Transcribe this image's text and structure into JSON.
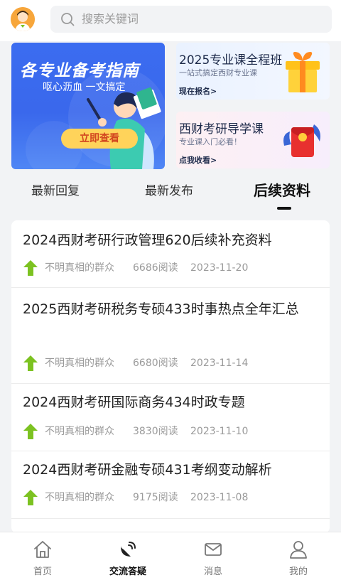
{
  "search": {
    "placeholder": "搜索关键词"
  },
  "banners": {
    "main": {
      "title": "各专业备考指南",
      "subtitle": "呕心沥血 一文搞定",
      "cta": "立即查看"
    },
    "side": [
      {
        "title": "2025专业课全程班",
        "subtitle": "一站式搞定西财专业课",
        "link": "现在报名>",
        "icon": "gift-box-icon"
      },
      {
        "title": "西财考研导学课",
        "subtitle": "专业课入门必看！",
        "link": "点我收看>",
        "icon": "red-envelope-icon"
      }
    ]
  },
  "tabs": [
    {
      "label": "最新回复",
      "active": false
    },
    {
      "label": "最新发布",
      "active": false
    },
    {
      "label": "后续资料",
      "active": true
    }
  ],
  "posts": [
    {
      "title": "2024西财考研行政管理620后续补充资料",
      "author": "不明真相的群众",
      "reads": "6686阅读",
      "date": "2023-11-20"
    },
    {
      "title": "2025西财考研税务专硕433时事热点全年汇总",
      "author": "不明真相的群众",
      "reads": "6680阅读",
      "date": "2023-11-14"
    },
    {
      "title": "2024西财考研国际商务434时政专题",
      "author": "不明真相的群众",
      "reads": "3830阅读",
      "date": "2023-11-10"
    },
    {
      "title": "2024西财考研金融专硕431考纲变动解析",
      "author": "不明真相的群众",
      "reads": "9175阅读",
      "date": "2023-11-08"
    }
  ],
  "bottom_nav": [
    {
      "label": "首页",
      "icon": "home-icon",
      "active": false
    },
    {
      "label": "交流答疑",
      "icon": "satellite-dish-icon",
      "active": true
    },
    {
      "label": "消息",
      "icon": "mail-icon",
      "active": false
    },
    {
      "label": "我的",
      "icon": "user-icon",
      "active": false
    }
  ],
  "colors": {
    "accent_green": "#7cc221",
    "banner_blue": "#3b6cf0",
    "cta_yellow": "#ffd35a"
  }
}
